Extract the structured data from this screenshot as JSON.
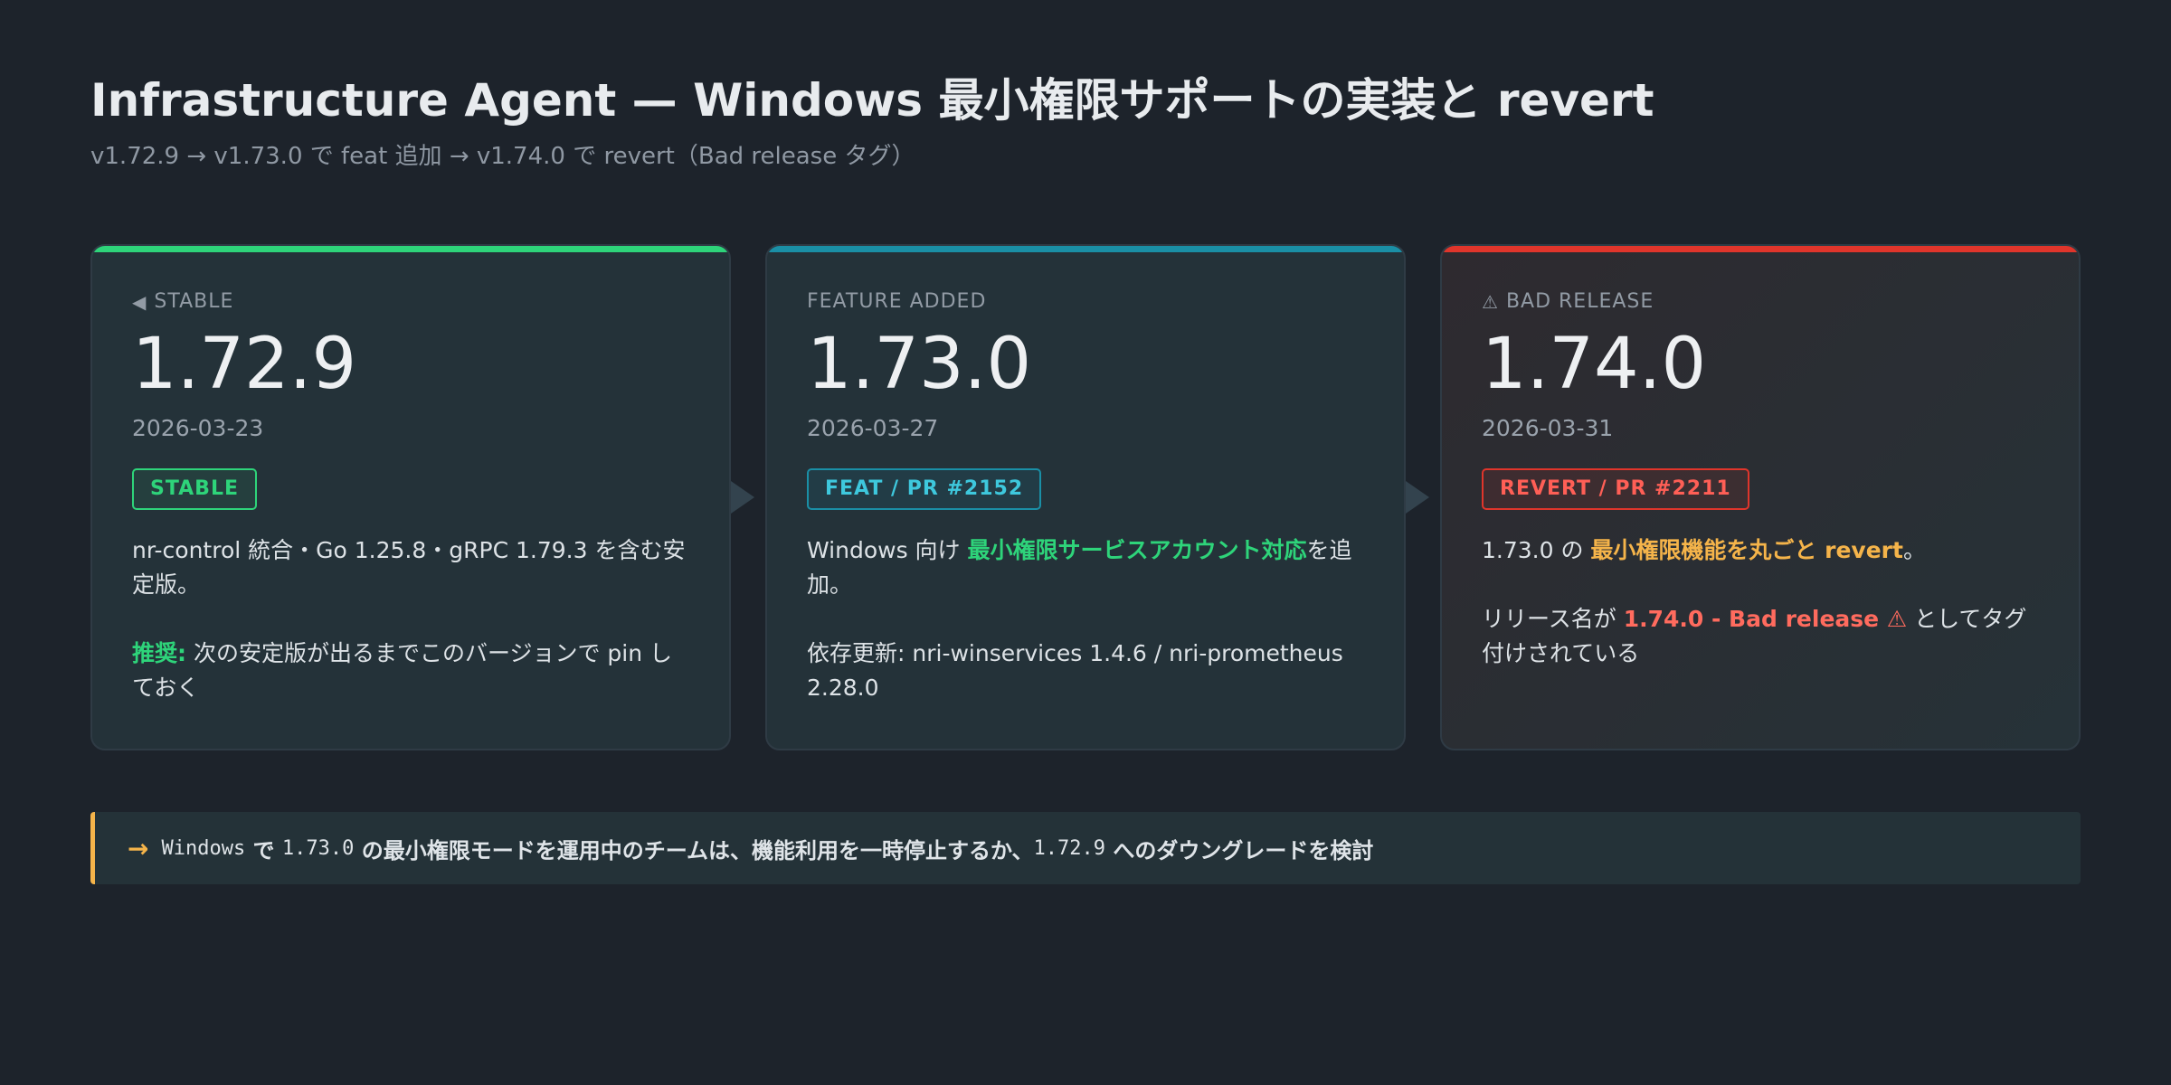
{
  "header": {
    "title": "Infrastructure Agent — Windows 最小権限サポートの実装と revert",
    "subtitle": "v1.72.9 → v1.73.0 で feat 追加 → v1.74.0 で revert（Bad release タグ）"
  },
  "cards": [
    {
      "status_icon": "◀",
      "status": "STABLE",
      "version": "1.72.9",
      "date": "2026-03-23",
      "tag": "STABLE",
      "desc1": "nr-control 統合・Go 1.25.8・gRPC 1.79.3 を含む安定版。",
      "desc2_label": "推奨:",
      "desc2": " 次の安定版が出るまでこのバージョンで pin しておく"
    },
    {
      "status": "FEATURE ADDED",
      "version": "1.73.0",
      "date": "2026-03-27",
      "tag": "FEAT / PR #2152",
      "desc1_pre": "Windows 向け ",
      "desc1_hl": "最小権限サービスアカウント対応",
      "desc1_post": "を追加。",
      "desc2": "依存更新: nri-winservices 1.4.6 / nri-prometheus 2.28.0"
    },
    {
      "status_icon": "⚠",
      "status": "BAD RELEASE",
      "version": "1.74.0",
      "date": "2026-03-31",
      "tag": "REVERT / PR #2211",
      "desc1_pre": "1.73.0 の ",
      "desc1_hl": "最小権限機能を丸ごと revert",
      "desc1_post": "。",
      "desc2_pre": "リリース名が ",
      "desc2_hl": "1.74.0 - Bad release ⚠",
      "desc2_post": " としてタグ付けされている"
    }
  ],
  "note": {
    "arrow": "→",
    "t1": "Windows",
    "t2": " で ",
    "t3": "1.73.0",
    "t4": " の最小権限モードを運用中のチームは、機能利用を一時停止するか、",
    "t5": "1.72.9",
    "t6": " へのダウングレードを検討"
  },
  "colors": {
    "stable": "#2ed47a",
    "feature": "#1a8fa6",
    "bad": "#e0352b",
    "warning": "#f5b44a"
  }
}
